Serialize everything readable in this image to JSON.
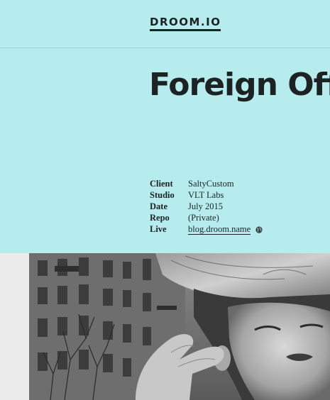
{
  "header": {
    "logo": "DROOM.IO"
  },
  "project": {
    "title": "Foreign Office"
  },
  "details": [
    {
      "label": "Client",
      "value": "SaltyCustom"
    },
    {
      "label": "Studio",
      "value": "VLT Labs"
    },
    {
      "label": "Date",
      "value": "July 2015"
    },
    {
      "label": "Repo",
      "value": "(Private)"
    },
    {
      "label": "Live",
      "value": "blog.droom.name",
      "icon": "globe-icon"
    }
  ],
  "colors": {
    "background": "#b7ecee",
    "text": "#1d2222",
    "gutter": "#ececec"
  }
}
